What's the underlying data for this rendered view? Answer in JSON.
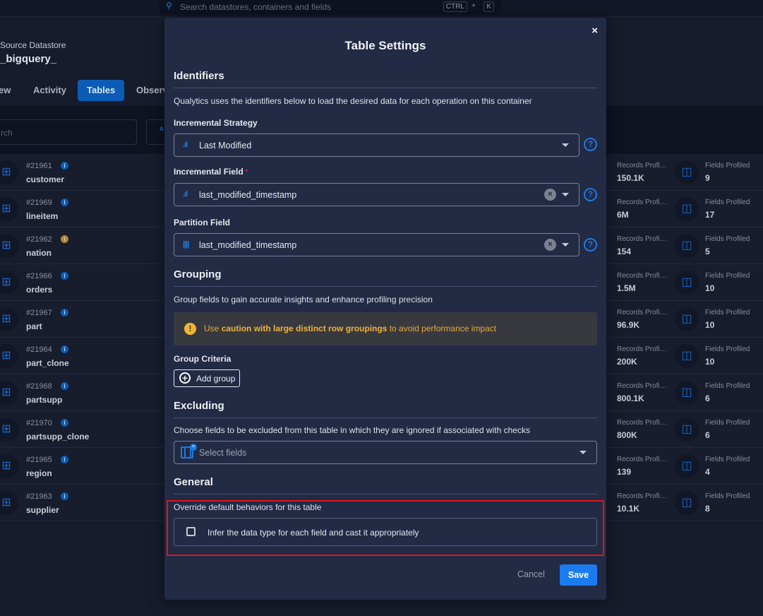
{
  "header": {
    "search_placeholder": "Search datastores, containers and fields",
    "shortcut_ctrl": "CTRL",
    "shortcut_plus": "+",
    "shortcut_k": "K"
  },
  "datastore": {
    "breadcrumb": "Source Datastore",
    "name": "_bigquery_"
  },
  "tabs": [
    {
      "label": "ew"
    },
    {
      "label": "Activity"
    },
    {
      "label": "Tables",
      "active": true
    },
    {
      "label": "Observ"
    }
  ],
  "filter": {
    "search_placeholder": "rch",
    "sort_label": "A Z"
  },
  "table_rows": [
    {
      "id": "#21961",
      "name": "customer",
      "info_color": "#0b5cb5",
      "records": "150.1K",
      "fields": "9"
    },
    {
      "id": "#21969",
      "name": "lineitem",
      "info_color": "#0b5cb5",
      "records": "6M",
      "fields": "17"
    },
    {
      "id": "#21962",
      "name": "nation",
      "info_color": "#b8862a",
      "records": "154",
      "fields": "5"
    },
    {
      "id": "#21966",
      "name": "orders",
      "info_color": "#0b5cb5",
      "records": "1.5M",
      "fields": "10"
    },
    {
      "id": "#21967",
      "name": "part",
      "info_color": "#0b5cb5",
      "records": "96.9K",
      "fields": "10"
    },
    {
      "id": "#21964",
      "name": "part_clone",
      "info_color": "#0b5cb5",
      "records": "200K",
      "fields": "10"
    },
    {
      "id": "#21968",
      "name": "partsupp",
      "info_color": "#0b5cb5",
      "records": "800.1K",
      "fields": "6"
    },
    {
      "id": "#21970",
      "name": "partsupp_clone",
      "info_color": "#0b5cb5",
      "records": "800K",
      "fields": "6"
    },
    {
      "id": "#21965",
      "name": "region",
      "info_color": "#0b5cb5",
      "records": "139",
      "fields": "4"
    },
    {
      "id": "#21963",
      "name": "supplier",
      "info_color": "#0b5cb5",
      "records": "10.1K",
      "fields": "8"
    }
  ],
  "row_labels": {
    "records": "Records Profiled",
    "fields": "Fields Profiled"
  },
  "modal": {
    "title": "Table Settings",
    "close": "×",
    "identifiers": {
      "heading": "Identifiers",
      "description": "Qualytics uses the identifiers below to load the desired data for each operation on this container",
      "incremental_strategy": {
        "label": "Incremental Strategy",
        "value": "Last Modified"
      },
      "incremental_field": {
        "label": "Incremental Field",
        "required": "•",
        "value": "last_modified_timestamp"
      },
      "partition_field": {
        "label": "Partition Field",
        "value": "last_modified_timestamp"
      },
      "help": "?",
      "clear": "×"
    },
    "grouping": {
      "heading": "Grouping",
      "description": "Group fields to gain accurate insights and enhance profiling precision",
      "warning_pre": "Use ",
      "warning_bold": "caution with large distinct row groupings",
      "warning_post": " to avoid performance impact",
      "criteria_label": "Group Criteria",
      "add_group": "Add group"
    },
    "excluding": {
      "heading": "Excluding",
      "description": "Choose fields to be excluded from this table in which they are ignored if associated with checks",
      "placeholder": "Select fields"
    },
    "general": {
      "heading": "General",
      "description": "Override default behaviors for this table",
      "infer_label": "Infer the data type for each field and cast it appropriately",
      "infer_checked": false
    },
    "cancel": "Cancel",
    "save": "Save"
  },
  "colors": {
    "accent": "#1a7cf0",
    "highlight": "#e0151b",
    "warning": "#f2b531"
  }
}
